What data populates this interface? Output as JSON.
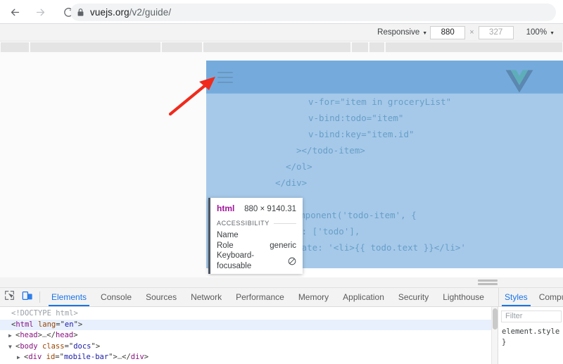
{
  "browser": {
    "back_icon": "arrow-left-icon",
    "forward_icon": "arrow-right-icon",
    "reload_icon": "reload-icon",
    "lock_icon": "lock-icon",
    "url_host": "vuejs.org",
    "url_path": "/v2/guide/"
  },
  "device_toolbar": {
    "device_label": "Responsive",
    "width_value": "880",
    "height_value": "327",
    "separator": "×",
    "zoom_label": "100%",
    "caret": "▼"
  },
  "viewport": {
    "hamburger_icon": "hamburger-menu-icon",
    "vue_logo_icon": "vue-logo-icon",
    "code_lines": [
      "v-for=\"item in groceryList\"",
      "v-bind:todo=\"item\"",
      "v-bind:key=\"item.id\"",
      "></todo-item>",
      "</ol>",
      "</div>",
      "Vue.component('todo-item', {",
      "props: ['todo'],",
      "template: '<li>{{ todo.text }}</li>'"
    ]
  },
  "tooltip": {
    "tag_name": "html",
    "dimensions": "880 × 9140.31",
    "section_title": "ACCESSIBILITY",
    "rows": [
      {
        "label": "Name",
        "value": ""
      },
      {
        "label": "Role",
        "value": "generic"
      },
      {
        "label": "Keyboard-focusable",
        "value": "",
        "icon": "not-allowed-icon"
      }
    ]
  },
  "devtools": {
    "inspect_icon": "inspect-element-icon",
    "device_toggle_icon": "device-toolbar-icon",
    "tabs": [
      "Elements",
      "Console",
      "Sources",
      "Network",
      "Performance",
      "Memory",
      "Application",
      "Security",
      "Lighthouse"
    ],
    "active_tab": "Elements",
    "dom": [
      {
        "indent": 0,
        "twisty": "",
        "text": "<!DOCTYPE html>",
        "type": "doctype",
        "selected": false
      },
      {
        "indent": 0,
        "twisty": "",
        "tag": "html",
        "attr": "lang",
        "value": "en",
        "type": "open",
        "selected": true
      },
      {
        "indent": 1,
        "twisty": "▶",
        "tag": "head",
        "type": "collapsed",
        "selected": false
      },
      {
        "indent": 1,
        "twisty": "▼",
        "tag": "body",
        "attr": "class",
        "value": "docs",
        "type": "open",
        "selected": false
      },
      {
        "indent": 2,
        "twisty": "▶",
        "tag": "div",
        "attr": "id",
        "value": "mobile-bar",
        "type": "collapsed",
        "selected": false
      }
    ],
    "styles": {
      "tabs": [
        "Styles",
        "Comput"
      ],
      "active_tab": "Styles",
      "filter_placeholder": "Filter",
      "rule_open": "element.style {",
      "rule_close": "}"
    }
  },
  "annotation": {
    "arrow_name": "red-pointer-arrow",
    "arrow_color": "#f02a1c"
  }
}
